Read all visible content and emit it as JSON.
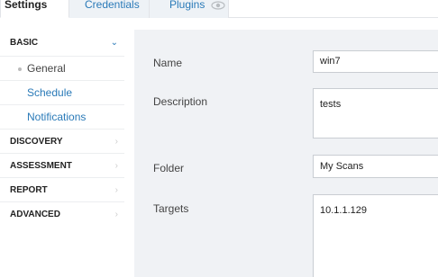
{
  "tabs": [
    {
      "label": "Settings"
    },
    {
      "label": "Credentials"
    },
    {
      "label": "Plugins"
    }
  ],
  "sidebar": {
    "sections": [
      {
        "label": "BASIC",
        "expanded": true
      },
      {
        "label": "DISCOVERY"
      },
      {
        "label": "ASSESSMENT"
      },
      {
        "label": "REPORT"
      },
      {
        "label": "ADVANCED"
      }
    ],
    "basic_items": [
      {
        "label": "General",
        "active": true
      },
      {
        "label": "Schedule"
      },
      {
        "label": "Notifications"
      }
    ],
    "chevron_open": "⌄",
    "chevron_closed": "›"
  },
  "form": {
    "name_label": "Name",
    "name_value": "win7",
    "description_label": "Description",
    "description_value": "tests",
    "folder_label": "Folder",
    "folder_value": "My Scans",
    "targets_label": "Targets",
    "targets_value": "10.1.1.129"
  },
  "colors": {
    "link": "#2a7ab8",
    "panel_bg": "#f0f2f5",
    "tab_inactive_bg": "#eef2f6"
  }
}
